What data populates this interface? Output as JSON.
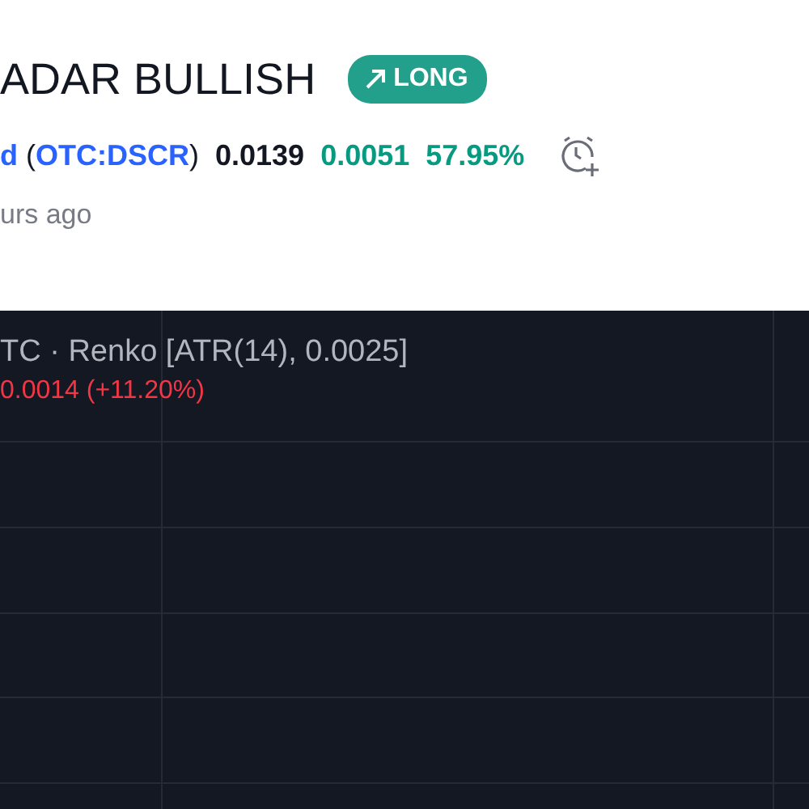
{
  "idea": {
    "title": "ADAR BULLISH",
    "badge": "LONG",
    "symbol": "d (OTC:DSCR)",
    "price": "0.0139",
    "change": "0.0051",
    "change_percent": "57.95%",
    "time": "urs ago"
  },
  "chart": {
    "legend": "TC · Renko [ATR(14), 0.0025]",
    "change": "0.0014 (+11.20%)"
  }
}
